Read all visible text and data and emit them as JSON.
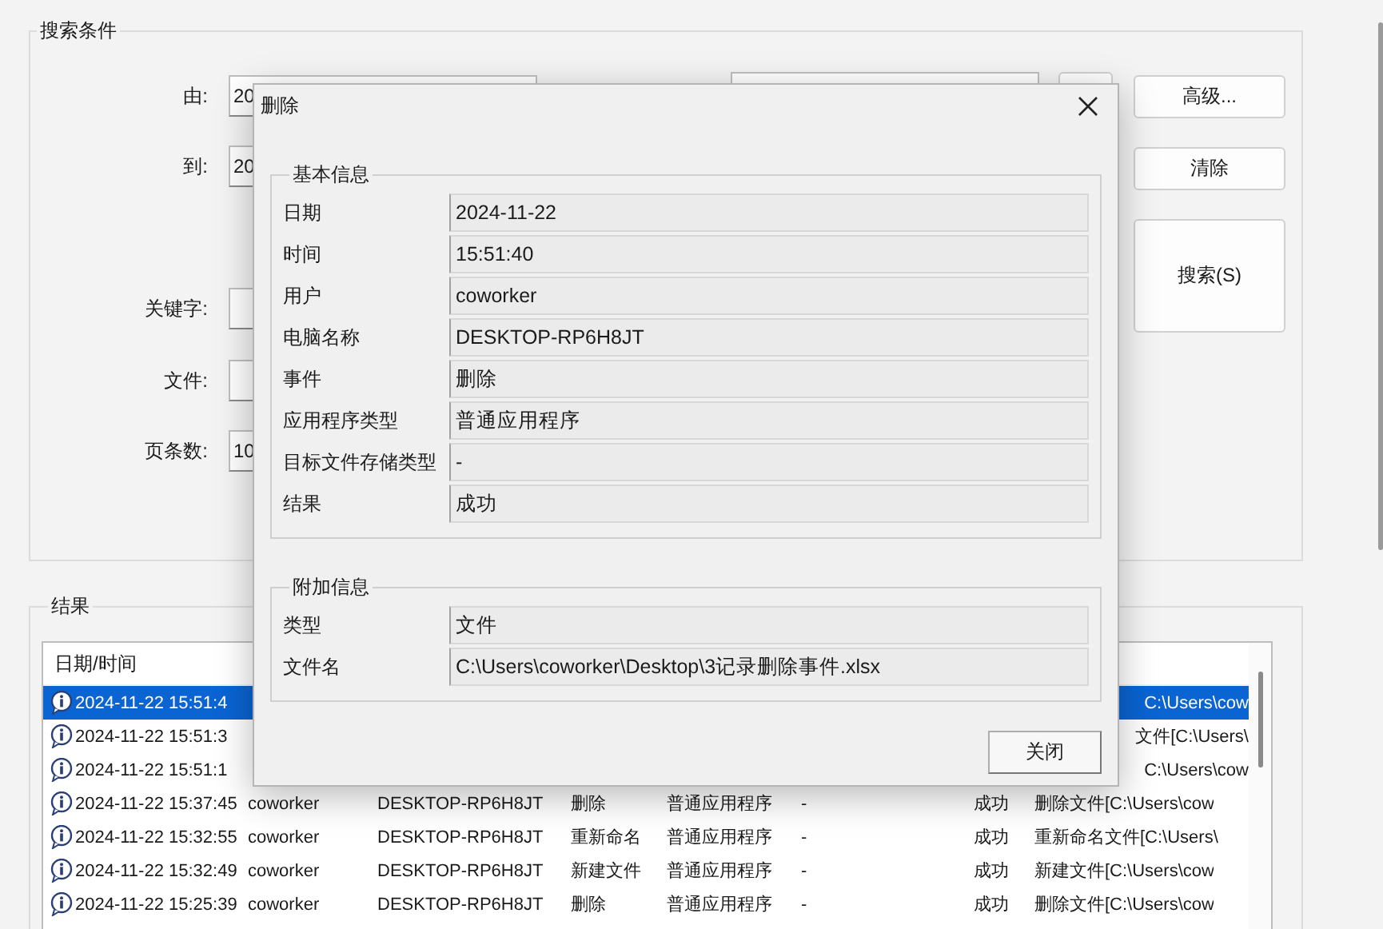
{
  "search": {
    "legend": "搜索条件",
    "rows": [
      {
        "label": "由:",
        "value": "20"
      },
      {
        "label": "到:",
        "value": "20"
      },
      {
        "label": "关键字:"
      },
      {
        "label": "文件:"
      },
      {
        "label": "页条数:",
        "value": "10"
      }
    ],
    "buttons": [
      "高级...",
      "清除",
      "搜索(S)"
    ]
  },
  "results": {
    "legend": "结果",
    "columns": [
      "日期/时间"
    ],
    "rows": [
      {
        "kind": "partial",
        "selected": true,
        "datetime": "2024-11-22 15:51:4",
        "description": "C:\\Users\\cow"
      },
      {
        "kind": "partial",
        "selected": false,
        "datetime": "2024-11-22 15:51:3",
        "description": "文件[C:\\Users\\"
      },
      {
        "kind": "partial",
        "selected": false,
        "datetime": "2024-11-22 15:51:1",
        "description": "C:\\Users\\cow"
      },
      {
        "kind": "full",
        "selected": false,
        "datetime": "2024-11-22 15:37:45",
        "user": "coworker",
        "computer": "DESKTOP-RP6H8JT",
        "event": "删除",
        "app_type": "普通应用程序",
        "storage": "-",
        "result": "成功",
        "description": "删除文件[C:\\Users\\cow"
      },
      {
        "kind": "full",
        "selected": false,
        "datetime": "2024-11-22 15:32:55",
        "user": "coworker",
        "computer": "DESKTOP-RP6H8JT",
        "event": "重新命名",
        "app_type": "普通应用程序",
        "storage": "-",
        "result": "成功",
        "description": "重新命名文件[C:\\Users\\"
      },
      {
        "kind": "full",
        "selected": false,
        "datetime": "2024-11-22 15:32:49",
        "user": "coworker",
        "computer": "DESKTOP-RP6H8JT",
        "event": "新建文件",
        "app_type": "普通应用程序",
        "storage": "-",
        "result": "成功",
        "description": "新建文件[C:\\Users\\cow"
      },
      {
        "kind": "full",
        "selected": false,
        "datetime": "2024-11-22 15:25:39",
        "user": "coworker",
        "computer": "DESKTOP-RP6H8JT",
        "event": "删除",
        "app_type": "普通应用程序",
        "storage": "-",
        "result": "成功",
        "description": "删除文件[C:\\Users\\cow"
      }
    ]
  },
  "dialog": {
    "title": "删除",
    "basic_info": {
      "legend": "基本信息",
      "rows": [
        {
          "label": "日期",
          "value": "2024-11-22"
        },
        {
          "label": "时间",
          "value": "15:51:40"
        },
        {
          "label": "用户",
          "value": "coworker"
        },
        {
          "label": "电脑名称",
          "value": "DESKTOP-RP6H8JT"
        },
        {
          "label": "事件",
          "value": "删除"
        },
        {
          "label": "应用程序类型",
          "value": "普通应用程序"
        },
        {
          "label": "目标文件存储类型",
          "value": "-"
        },
        {
          "label": "结果",
          "value": "成功"
        }
      ]
    },
    "extra_info": {
      "legend": "附加信息",
      "rows": [
        {
          "label": "类型",
          "value": "文件"
        },
        {
          "label": "文件名",
          "value": "C:\\Users\\coworker\\Desktop\\3记录删除事件.xlsx"
        }
      ]
    },
    "close_button": "关闭"
  }
}
